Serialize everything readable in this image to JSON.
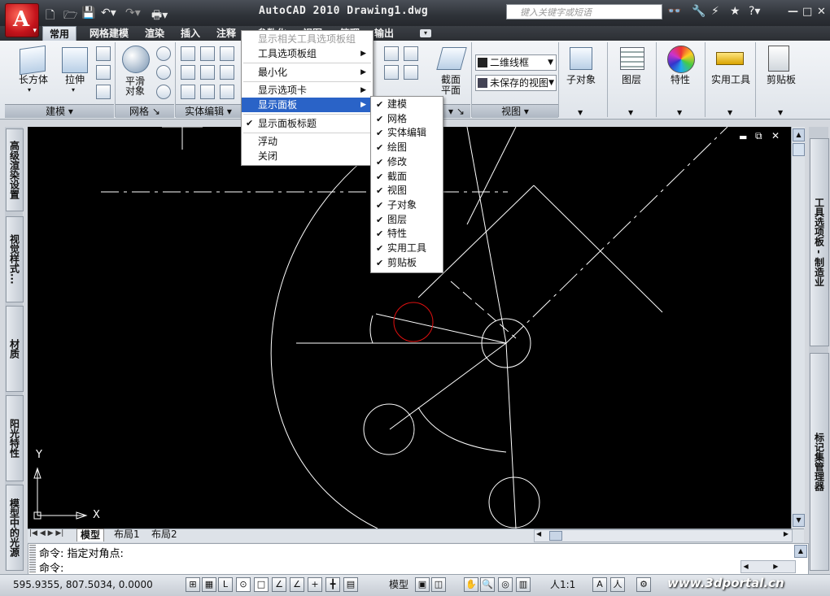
{
  "app": {
    "title": "AutoCAD 2010   Drawing1.dwg",
    "search_placeholder": "键入关键字或短语",
    "brand_color": "#c4131b"
  },
  "tabs": [
    "常用",
    "网格建模",
    "渲染",
    "插入",
    "注释",
    "参数化",
    "视图",
    "管理",
    "输出"
  ],
  "ribbon": {
    "model_panel": {
      "box_label": "长方体",
      "extrude_label": "拉伸",
      "footer": "建模"
    },
    "mesh_panel": {
      "smooth_label_1": "平滑",
      "smooth_label_2": "对象",
      "footer": "网格"
    },
    "solid_panel": {
      "footer": "实体编辑"
    },
    "section_panel": {
      "label_1": "截面",
      "label_2": "平面"
    },
    "view_panel": {
      "visual_style": "二维线框",
      "saved_view": "未保存的视图",
      "footer": "视图"
    },
    "subobject_label": "子对象",
    "layers_label": "图层",
    "properties_label": "特性",
    "utilities_label": "实用工具",
    "clipboard_label": "剪贴板"
  },
  "context_menu": {
    "items": [
      {
        "label": "显示相关工具选项板组",
        "disabled": true
      },
      {
        "label": "工具选项板组",
        "submenu": true
      },
      {
        "label": "最小化",
        "submenu": true
      },
      {
        "label": "显示选项卡",
        "submenu": true
      },
      {
        "label": "显示面板",
        "submenu": true,
        "highlighted": true
      },
      {
        "label": "显示面板标题",
        "checked": true
      },
      {
        "label": "浮动"
      },
      {
        "label": "关闭"
      }
    ]
  },
  "submenu": {
    "items": [
      "建模",
      "网格",
      "实体编辑",
      "绘图",
      "修改",
      "截面",
      "视图",
      "子对象",
      "图层",
      "特性",
      "实用工具",
      "剪贴板"
    ]
  },
  "left_palette": [
    "高级渲染设置",
    "视觉样式...",
    "材质",
    "阳光特性",
    "模型中的光源"
  ],
  "right_palette": [
    "工具选项板 - 制造业",
    "标记集管理器"
  ],
  "layout_tabs": [
    "模型",
    "布局1",
    "布局2"
  ],
  "command": {
    "line1": "命令: 指定对角点:",
    "line2": "命令:"
  },
  "status": {
    "coords": "595.9355,  807.5034, 0.0000",
    "model_label": "模型",
    "scale": "人1:1",
    "watermark": "www.3dportal.cn"
  },
  "ucs": {
    "x_label": "X",
    "y_label": "Y"
  }
}
